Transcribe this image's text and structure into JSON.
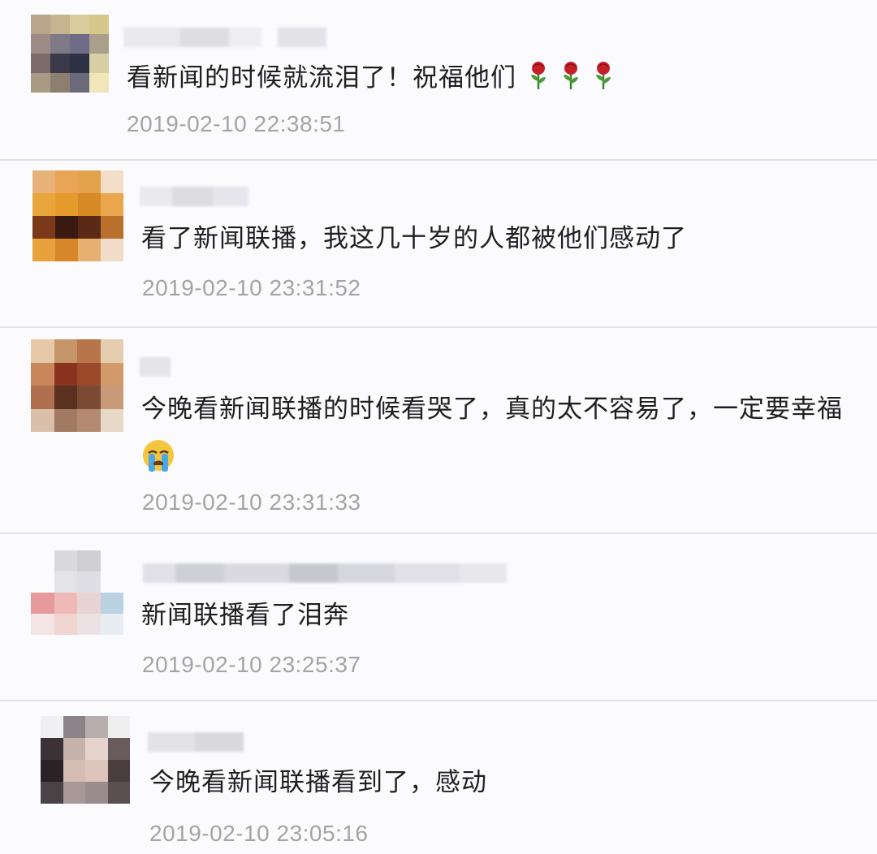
{
  "comments": [
    {
      "text": "看新闻的时候就流泪了！祝福他们",
      "time": "2019-02-10 22:38:51",
      "icons": [
        "rose-icon",
        "rose-icon",
        "rose-icon"
      ]
    },
    {
      "text": "看了新闻联播，我这几十岁的人都被他们感动了",
      "time": "2019-02-10 23:31:52"
    },
    {
      "text": "今晚看新闻联播的时候看哭了，真的太不容易了，一定要幸福",
      "time": "2019-02-10 23:31:33",
      "icons": [
        "crying-face-emoji"
      ]
    },
    {
      "text": "新闻联播看了泪奔",
      "time": "2019-02-10 23:25:37"
    },
    {
      "text": "今晚看新闻联播看到了，感动",
      "time": "2019-02-10 23:05:16"
    }
  ]
}
